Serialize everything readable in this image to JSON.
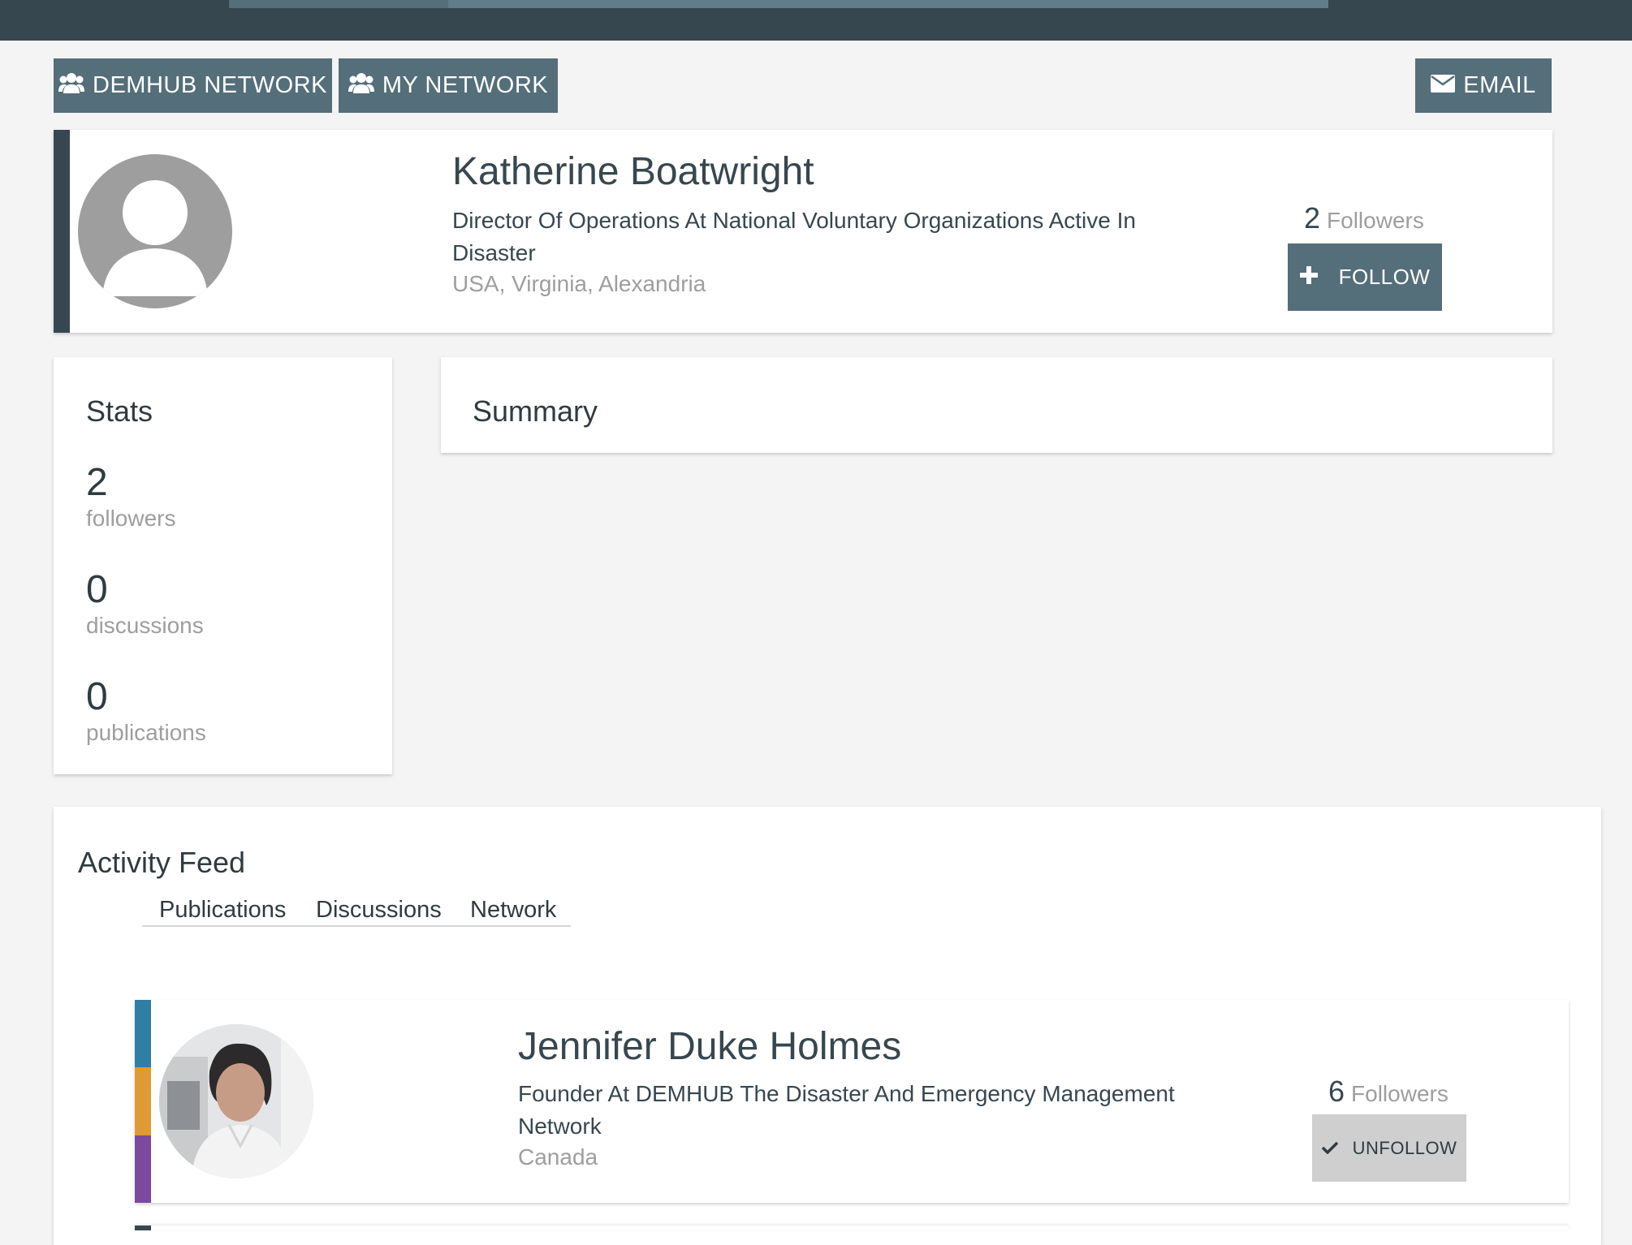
{
  "toolbar": {
    "demhub_network_label": "DEMHUB NETWORK",
    "my_network_label": "MY NETWORK",
    "email_label": "EMAIL"
  },
  "profile": {
    "name": "Katherine Boatwright",
    "title": "Director Of Operations At National Voluntary Organizations Active In Disaster",
    "location": "USA, Virginia, Alexandria",
    "followers_count": "2",
    "followers_label": "Followers",
    "follow_label": "FOLLOW"
  },
  "stats": {
    "heading": "Stats",
    "items": [
      {
        "value": "2",
        "label": "followers"
      },
      {
        "value": "0",
        "label": "discussions"
      },
      {
        "value": "0",
        "label": "publications"
      }
    ]
  },
  "summary": {
    "heading": "Summary"
  },
  "activity": {
    "heading": "Activity Feed",
    "tabs": [
      "Publications",
      "Discussions",
      "Network"
    ],
    "items": [
      {
        "name": "Jennifer Duke Holmes",
        "title": "Founder At DEMHUB The Disaster And Emergency Management Network",
        "location": "Canada",
        "followers_count": "6",
        "followers_label": "Followers",
        "action_label": "UNFOLLOW",
        "accent_colors": [
          "#2e7ea6",
          "#e09a35",
          "#7a4a9e"
        ]
      }
    ]
  },
  "colors": {
    "topbar": "#37474f",
    "button": "#546e7a",
    "unfollow_button": "#cfcfcf"
  }
}
